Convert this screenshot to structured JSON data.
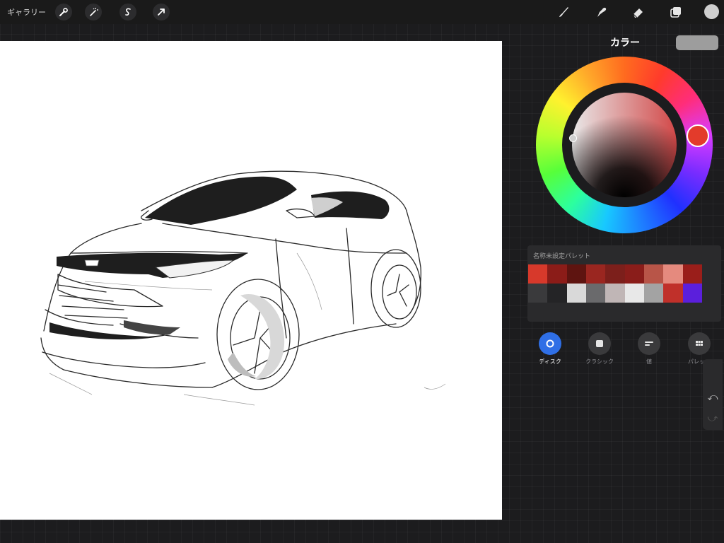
{
  "topbar": {
    "gallery_label": "ギャラリー",
    "left_tools": [
      "wrench-icon",
      "magic-wand-icon",
      "selection-s-icon",
      "move-arrow-icon"
    ],
    "right_tools": [
      "brush-icon",
      "smudge-icon",
      "eraser-icon",
      "layers-icon"
    ],
    "current_color": "#cfcfcf"
  },
  "color_panel": {
    "title": "カラー",
    "preview_color": "#9d9d9d",
    "selected_hue": "#e33b2b",
    "palette_name": "名称未設定パレット",
    "palette_colors": [
      "#d7392b",
      "#8b1c18",
      "#5e1410",
      "#9a2620",
      "#7c1f1b",
      "#8a1d1a",
      "#b85548",
      "#e58a7e",
      "#9a1e1a",
      "#3a3a3c",
      "#242426",
      "#d9d9d9",
      "#6a6a6c",
      "#c0b6b6",
      "#e8e8e8",
      "#a3a3a3",
      "#c0302a",
      "#5b1fdc"
    ],
    "modes": [
      {
        "label": "ディスク",
        "active": true
      },
      {
        "label": "クラシック",
        "active": false
      },
      {
        "label": "値",
        "active": false
      },
      {
        "label": "パレット",
        "active": false
      }
    ]
  },
  "side": {
    "undo_glyph": "⤺",
    "redo_glyph": "⤻"
  }
}
